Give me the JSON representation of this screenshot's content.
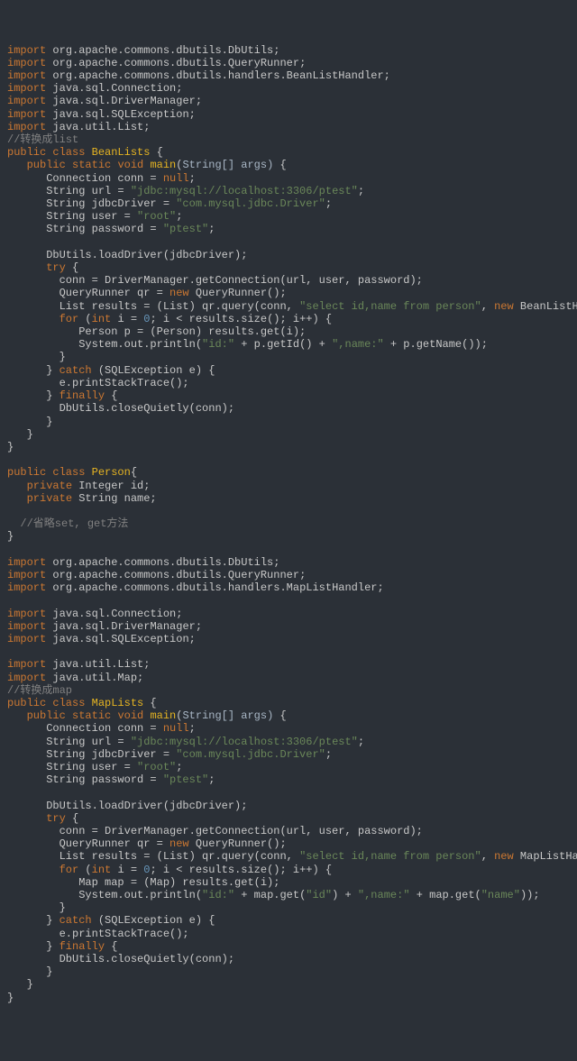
{
  "lines": [
    [
      [
        "kw",
        "import"
      ],
      [
        "",
        " org.apache.commons.dbutils.DbUtils;"
      ]
    ],
    [
      [
        "kw",
        "import"
      ],
      [
        "",
        " org.apache.commons.dbutils.QueryRunner;"
      ]
    ],
    [
      [
        "kw",
        "import"
      ],
      [
        "",
        " org.apache.commons.dbutils.handlers.BeanListHandler;"
      ]
    ],
    [
      [
        "kw",
        "import"
      ],
      [
        "",
        " java.sql.Connection;"
      ]
    ],
    [
      [
        "kw",
        "import"
      ],
      [
        "",
        " java.sql.DriverManager;"
      ]
    ],
    [
      [
        "kw",
        "import"
      ],
      [
        "",
        " java.sql.SQLException;"
      ]
    ],
    [
      [
        "kw",
        "import"
      ],
      [
        "",
        " java.util.List;"
      ]
    ],
    [
      [
        "cmt",
        "//转换成list"
      ]
    ],
    [
      [
        "kw",
        "public class "
      ],
      [
        "cls",
        "BeanLists"
      ],
      [
        "",
        " {"
      ]
    ],
    [
      [
        "",
        "   "
      ],
      [
        "kw",
        "public static "
      ],
      [
        "typ",
        "void "
      ],
      [
        "mth",
        "main"
      ],
      [
        "",
        "("
      ],
      [
        "par",
        "String[] args)"
      ],
      [
        "",
        " {"
      ]
    ],
    [
      [
        "",
        "      Connection conn = "
      ],
      [
        "nul",
        "null"
      ],
      [
        "",
        ";"
      ]
    ],
    [
      [
        "",
        "      String url = "
      ],
      [
        "str",
        "\"jdbc:mysql://localhost:3306/ptest\""
      ],
      [
        "",
        ";"
      ]
    ],
    [
      [
        "",
        "      String jdbcDriver = "
      ],
      [
        "str",
        "\"com.mysql.jdbc.Driver\""
      ],
      [
        "",
        ";"
      ]
    ],
    [
      [
        "",
        "      String user = "
      ],
      [
        "str",
        "\"root\""
      ],
      [
        "",
        ";"
      ]
    ],
    [
      [
        "",
        "      String password = "
      ],
      [
        "str",
        "\"ptest\""
      ],
      [
        "",
        ";"
      ]
    ],
    [
      [
        "",
        ""
      ]
    ],
    [
      [
        "",
        "      DbUtils.loadDriver(jdbcDriver);"
      ]
    ],
    [
      [
        "",
        "      "
      ],
      [
        "kw",
        "try"
      ],
      [
        "",
        " {"
      ]
    ],
    [
      [
        "",
        "        conn = DriverManager.getConnection(url, user, password);"
      ]
    ],
    [
      [
        "",
        "        QueryRunner qr = "
      ],
      [
        "kw",
        "new "
      ],
      [
        "",
        "QueryRunner();"
      ]
    ],
    [
      [
        "",
        "        List results = (List) qr.query(conn, "
      ],
      [
        "str",
        "\"select id,name from person\""
      ],
      [
        "",
        ", "
      ],
      [
        "kw",
        "new "
      ],
      [
        "",
        "BeanListHandler(Person"
      ]
    ],
    [
      [
        "",
        "        "
      ],
      [
        "kw",
        "for"
      ],
      [
        "",
        " ("
      ],
      [
        "typ",
        "int "
      ],
      [
        "",
        "i = "
      ],
      [
        "num",
        "0"
      ],
      [
        "",
        "; i < results.size(); i++) {"
      ]
    ],
    [
      [
        "",
        "           Person p = (Person) results.get(i);"
      ]
    ],
    [
      [
        "",
        "           System.out.println("
      ],
      [
        "str",
        "\"id:\""
      ],
      [
        "",
        " + p.getId() + "
      ],
      [
        "str",
        "\",name:\""
      ],
      [
        "",
        " + p.getName());"
      ]
    ],
    [
      [
        "",
        "        }"
      ]
    ],
    [
      [
        "",
        "      } "
      ],
      [
        "kw",
        "catch"
      ],
      [
        "",
        " (SQLException e) {"
      ]
    ],
    [
      [
        "",
        "        e.printStackTrace();"
      ]
    ],
    [
      [
        "",
        "      } "
      ],
      [
        "kw",
        "finally"
      ],
      [
        "",
        " {"
      ]
    ],
    [
      [
        "",
        "        DbUtils.closeQuietly(conn);"
      ]
    ],
    [
      [
        "",
        "      }"
      ]
    ],
    [
      [
        "",
        "   }"
      ]
    ],
    [
      [
        "",
        "}"
      ]
    ],
    [
      [
        "",
        ""
      ]
    ],
    [
      [
        "kw",
        "public class "
      ],
      [
        "cls",
        "Person"
      ],
      [
        "",
        "{"
      ]
    ],
    [
      [
        "",
        "   "
      ],
      [
        "kw",
        "private "
      ],
      [
        "",
        "Integer id;"
      ]
    ],
    [
      [
        "",
        "   "
      ],
      [
        "kw",
        "private "
      ],
      [
        "",
        "String name;"
      ]
    ],
    [
      [
        "",
        ""
      ]
    ],
    [
      [
        "",
        "  "
      ],
      [
        "cmt",
        "//省略set, get方法"
      ]
    ],
    [
      [
        "",
        "}"
      ]
    ],
    [
      [
        "",
        ""
      ]
    ],
    [
      [
        "kw",
        "import"
      ],
      [
        "",
        " org.apache.commons.dbutils.DbUtils;"
      ]
    ],
    [
      [
        "kw",
        "import"
      ],
      [
        "",
        " org.apache.commons.dbutils.QueryRunner;"
      ]
    ],
    [
      [
        "kw",
        "import"
      ],
      [
        "",
        " org.apache.commons.dbutils.handlers.MapListHandler;"
      ]
    ],
    [
      [
        "",
        ""
      ]
    ],
    [
      [
        "kw",
        "import"
      ],
      [
        "",
        " java.sql.Connection;"
      ]
    ],
    [
      [
        "kw",
        "import"
      ],
      [
        "",
        " java.sql.DriverManager;"
      ]
    ],
    [
      [
        "kw",
        "import"
      ],
      [
        "",
        " java.sql.SQLException;"
      ]
    ],
    [
      [
        "",
        ""
      ]
    ],
    [
      [
        "kw",
        "import"
      ],
      [
        "",
        " java.util.List;"
      ]
    ],
    [
      [
        "kw",
        "import"
      ],
      [
        "",
        " java.util.Map;"
      ]
    ],
    [
      [
        "cmt",
        "//转换成map"
      ]
    ],
    [
      [
        "kw",
        "public class "
      ],
      [
        "cls",
        "MapLists"
      ],
      [
        "",
        " {"
      ]
    ],
    [
      [
        "",
        "   "
      ],
      [
        "kw",
        "public static "
      ],
      [
        "typ",
        "void "
      ],
      [
        "mth",
        "main"
      ],
      [
        "",
        "("
      ],
      [
        "par",
        "String[] args)"
      ],
      [
        "",
        " {"
      ]
    ],
    [
      [
        "",
        "      Connection conn = "
      ],
      [
        "nul",
        "null"
      ],
      [
        "",
        ";"
      ]
    ],
    [
      [
        "",
        "      String url = "
      ],
      [
        "str",
        "\"jdbc:mysql://localhost:3306/ptest\""
      ],
      [
        "",
        ";"
      ]
    ],
    [
      [
        "",
        "      String jdbcDriver = "
      ],
      [
        "str",
        "\"com.mysql.jdbc.Driver\""
      ],
      [
        "",
        ";"
      ]
    ],
    [
      [
        "",
        "      String user = "
      ],
      [
        "str",
        "\"root\""
      ],
      [
        "",
        ";"
      ]
    ],
    [
      [
        "",
        "      String password = "
      ],
      [
        "str",
        "\"ptest\""
      ],
      [
        "",
        ";"
      ]
    ],
    [
      [
        "",
        ""
      ]
    ],
    [
      [
        "",
        "      DbUtils.loadDriver(jdbcDriver);"
      ]
    ],
    [
      [
        "",
        "      "
      ],
      [
        "kw",
        "try"
      ],
      [
        "",
        " {"
      ]
    ],
    [
      [
        "",
        "        conn = DriverManager.getConnection(url, user, password);"
      ]
    ],
    [
      [
        "",
        "        QueryRunner qr = "
      ],
      [
        "kw",
        "new "
      ],
      [
        "",
        "QueryRunner();"
      ]
    ],
    [
      [
        "",
        "        List results = (List) qr.query(conn, "
      ],
      [
        "str",
        "\"select id,name from person\""
      ],
      [
        "",
        ", "
      ],
      [
        "kw",
        "new "
      ],
      [
        "",
        "MapListHandler());"
      ]
    ],
    [
      [
        "",
        "        "
      ],
      [
        "kw",
        "for"
      ],
      [
        "",
        " ("
      ],
      [
        "typ",
        "int "
      ],
      [
        "",
        "i = "
      ],
      [
        "num",
        "0"
      ],
      [
        "",
        "; i < results.size(); i++) {"
      ]
    ],
    [
      [
        "",
        "           Map map = (Map) results.get(i);"
      ]
    ],
    [
      [
        "",
        "           System.out.println("
      ],
      [
        "str",
        "\"id:\""
      ],
      [
        "",
        " + map.get("
      ],
      [
        "str",
        "\"id\""
      ],
      [
        "",
        ") + "
      ],
      [
        "str",
        "\",name:\""
      ],
      [
        "",
        " + map.get("
      ],
      [
        "str",
        "\"name\""
      ],
      [
        "",
        "));"
      ]
    ],
    [
      [
        "",
        "        }"
      ]
    ],
    [
      [
        "",
        "      } "
      ],
      [
        "kw",
        "catch"
      ],
      [
        "",
        " (SQLException e) {"
      ]
    ],
    [
      [
        "",
        "        e.printStackTrace();"
      ]
    ],
    [
      [
        "",
        "      } "
      ],
      [
        "kw",
        "finally"
      ],
      [
        "",
        " {"
      ]
    ],
    [
      [
        "",
        "        DbUtils.closeQuietly(conn);"
      ]
    ],
    [
      [
        "",
        "      }"
      ]
    ],
    [
      [
        "",
        "   }"
      ]
    ],
    [
      [
        "",
        "}"
      ]
    ]
  ]
}
